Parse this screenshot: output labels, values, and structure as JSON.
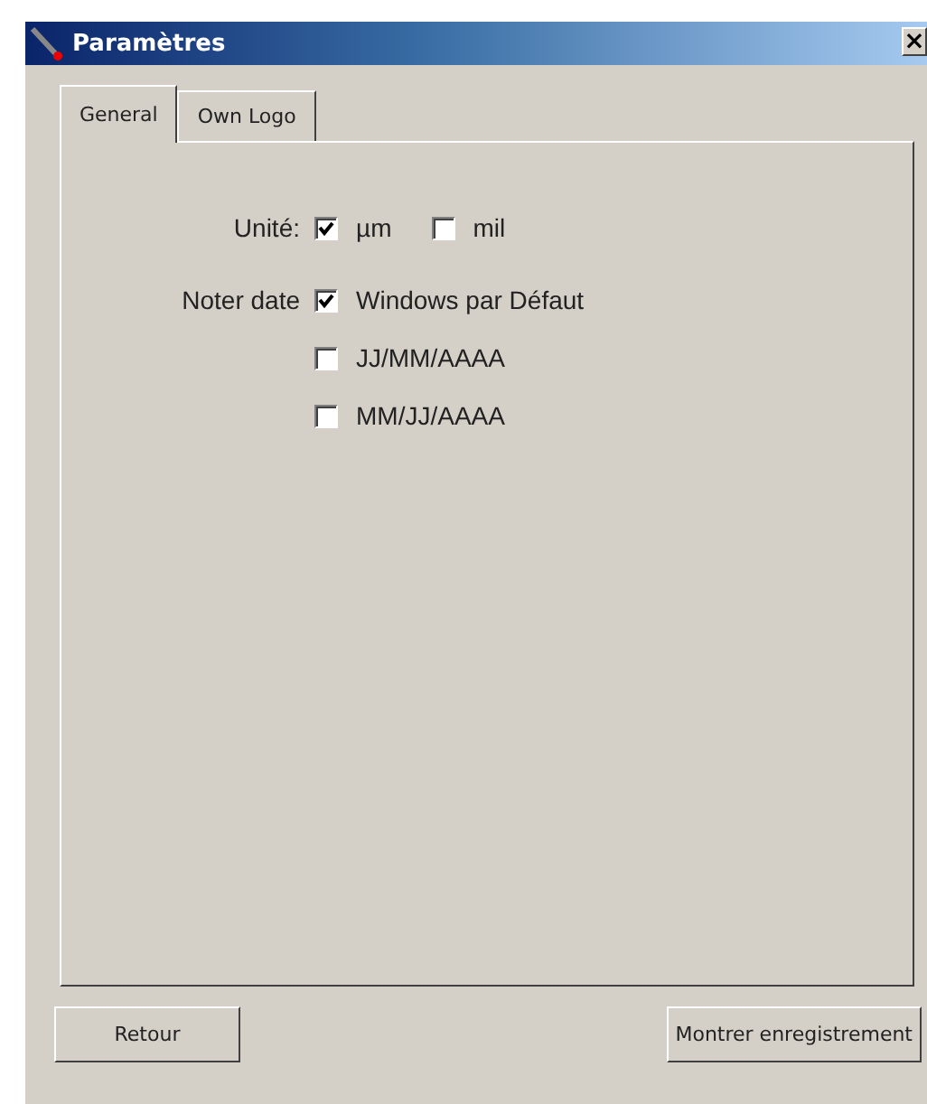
{
  "window": {
    "title": "Paramètres",
    "close": "×"
  },
  "tabs": [
    {
      "label": "General",
      "selected": true
    },
    {
      "label": "Own Logo",
      "selected": false
    }
  ],
  "unit": {
    "label": "Unité:",
    "options": [
      {
        "label": "µm",
        "checked": true
      },
      {
        "label": "mil",
        "checked": false
      }
    ]
  },
  "date": {
    "label": "Noter date",
    "options": [
      {
        "label": "Windows par Défaut",
        "checked": true
      },
      {
        "label": "JJ/MM/AAAA",
        "checked": false
      },
      {
        "label": "MM/JJ/AAAA",
        "checked": false
      }
    ]
  },
  "buttons": [
    "Retour",
    "Montrer enregistrement"
  ]
}
